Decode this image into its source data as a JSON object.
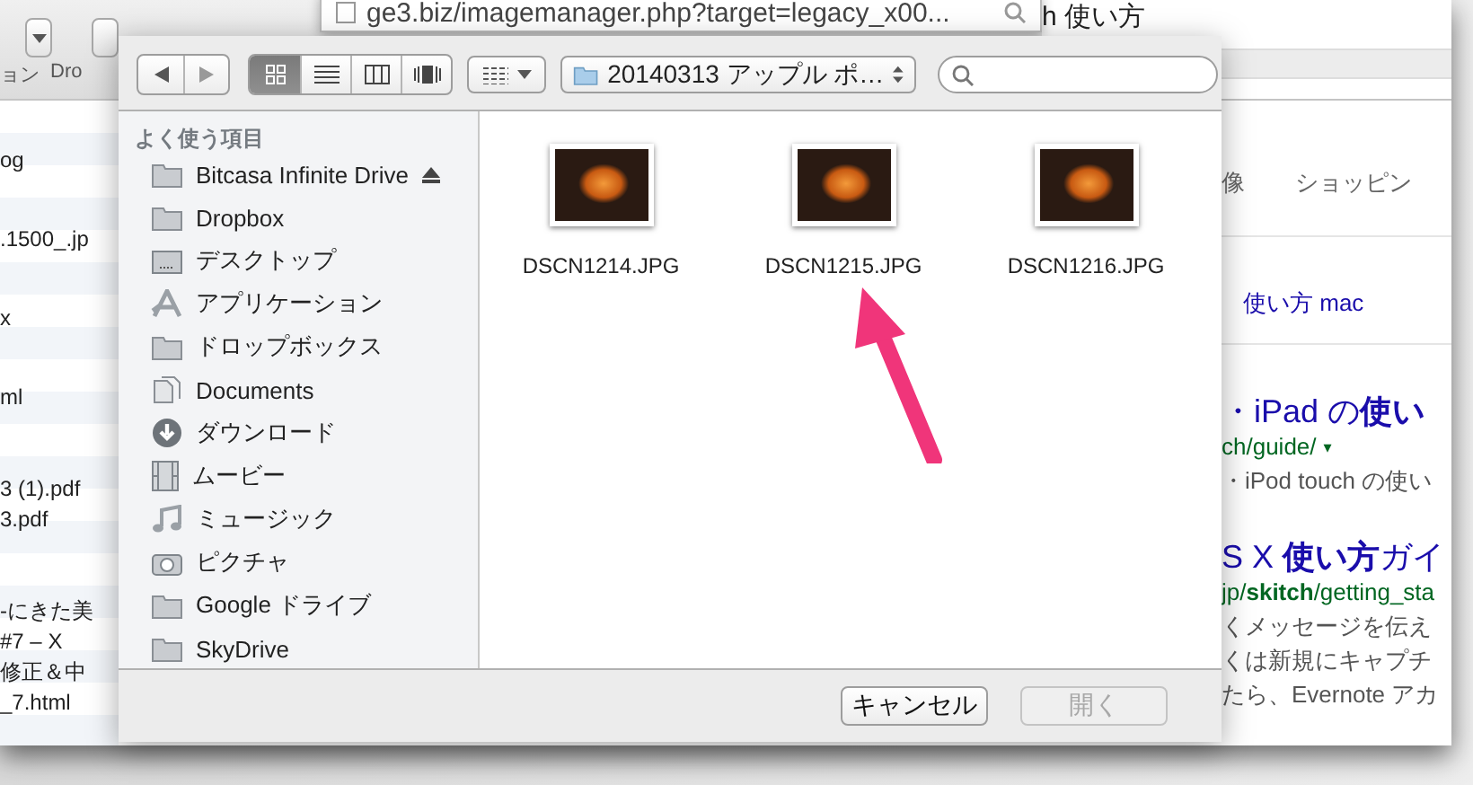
{
  "background_app": {
    "toolbar_labels": [
      "ョン",
      "Dro"
    ],
    "file_list": {
      "groups": [
        {
          "kind": "sparse",
          "items": [
            "og",
            ".1500_.jp",
            "x",
            "ml"
          ]
        },
        {
          "kind": "dense",
          "items": [
            "3 (1).pdf",
            "3.pdf"
          ]
        },
        {
          "kind": "dense",
          "items": [
            "-にきた美",
            "#7 – X",
            "修正＆中",
            "_7.html"
          ]
        }
      ]
    }
  },
  "browser": {
    "address_popup": "ge3.biz/imagemanager.php?target=legacy_x00...",
    "search_title": "h 使い方",
    "search_tabs": [
      "像",
      "ショッピン"
    ],
    "related": "使い方 mac",
    "results": [
      {
        "title": "・iPad の**使い**",
        "url": "ch/guide/",
        "url_menu": "▾",
        "snippets": [
          "・iPod touch の使い"
        ]
      },
      {
        "title": "S X **使い方**ガイ",
        "url": "jp/**skitch**/getting_sta",
        "snippets": [
          "くメッセージを伝え",
          "くは新規にキャプチ",
          "たら、Evernote アカ"
        ]
      }
    ]
  },
  "dialog": {
    "view_modes": [
      {
        "kind": "icon",
        "selected": true
      },
      {
        "kind": "list",
        "selected": false
      },
      {
        "kind": "column",
        "selected": false
      },
      {
        "kind": "coverflow",
        "selected": false
      }
    ],
    "path": "20140313 アップル ポ…",
    "sidebar": {
      "header": "よく使う項目",
      "items": [
        {
          "label": "Bitcasa Infinite Drive",
          "kind": "folder",
          "ejectable": true
        },
        {
          "label": "Dropbox",
          "kind": "folder",
          "ejectable": false
        },
        {
          "label": "デスクトップ",
          "kind": "desktop",
          "ejectable": false
        },
        {
          "label": "アプリケーション",
          "kind": "apps",
          "ejectable": false
        },
        {
          "label": "ドロップボックス",
          "kind": "folder",
          "ejectable": false
        },
        {
          "label": "Documents",
          "kind": "documents",
          "ejectable": false
        },
        {
          "label": "ダウンロード",
          "kind": "download",
          "ejectable": false
        },
        {
          "label": "ムービー",
          "kind": "movies",
          "ejectable": false
        },
        {
          "label": "ミュージック",
          "kind": "music",
          "ejectable": false
        },
        {
          "label": "ピクチャ",
          "kind": "pictures",
          "ejectable": false
        },
        {
          "label": "Google ドライブ",
          "kind": "folder",
          "ejectable": false
        },
        {
          "label": "SkyDrive",
          "kind": "folder",
          "ejectable": false
        }
      ]
    },
    "files": [
      {
        "name": "DSCN1214.JPG"
      },
      {
        "name": "DSCN1215.JPG"
      },
      {
        "name": "DSCN1216.JPG"
      }
    ],
    "buttons": [
      {
        "label": "キャンセル",
        "disabled": false
      },
      {
        "label": "開く",
        "disabled": true
      }
    ]
  }
}
